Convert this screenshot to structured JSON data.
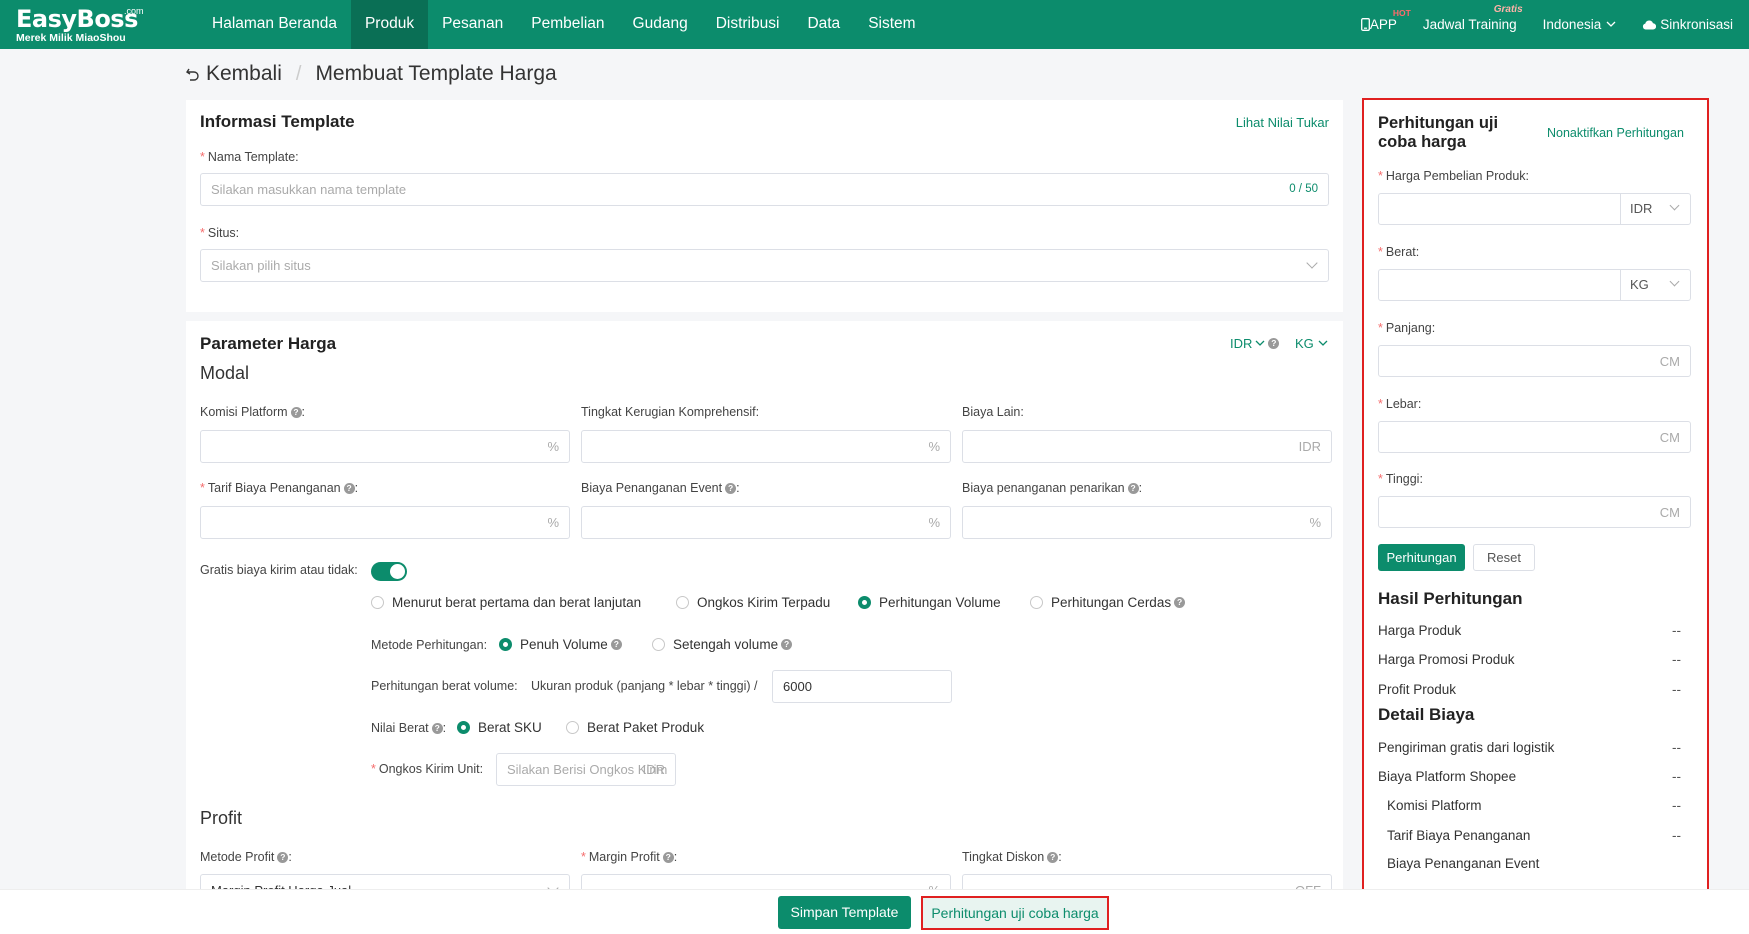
{
  "nav": {
    "logo": "EasyBoss",
    "logo_com": ".com",
    "logo_tag": "Merek Milik MiaoShou",
    "menu": [
      "Halaman Beranda",
      "Produk",
      "Pesanan",
      "Pembelian",
      "Gudang",
      "Distribusi",
      "Data",
      "Sistem"
    ],
    "active_index": 1,
    "app": "APP",
    "app_badge": "HOT",
    "training": "Jadwal Training",
    "training_badge": "Gratis",
    "language": "Indonesia",
    "sync": "Sinkronisasi"
  },
  "header": {
    "back": "Kembali",
    "separator": "/",
    "title": "Membuat Template Harga"
  },
  "template_info": {
    "title": "Informasi Template",
    "exchange_link": "Lihat Nilai Tukar",
    "name_label": "Nama Template:",
    "name_placeholder": "Silakan masukkan nama template",
    "name_count": "0 / 50",
    "site_label": "Situs:",
    "site_placeholder": "Silakan pilih situs"
  },
  "price_params": {
    "title": "Parameter Harga",
    "currency": "IDR",
    "weight_unit": "KG",
    "modal_title": "Modal",
    "commission_label": "Komisi Platform",
    "commission_suffix": "%",
    "loss_label": "Tingkat Kerugian Komprehensif:",
    "loss_suffix": "%",
    "other_label": "Biaya Lain:",
    "other_suffix": "IDR",
    "handling_label": "Tarif Biaya Penanganan",
    "handling_suffix": "%",
    "event_label": "Biaya Penanganan Event",
    "event_suffix": "%",
    "withdraw_label": "Biaya penanganan penarikan",
    "withdraw_suffix": "%",
    "free_ship_label": "Gratis biaya kirim atau tidak:",
    "free_ship_on": true,
    "ship_options": [
      "Menurut berat pertama dan berat lanjutan",
      "Ongkos Kirim Terpadu",
      "Perhitungan Volume",
      "Perhitungan Cerdas"
    ],
    "ship_selected": 2,
    "calc_method_label": "Metode Perhitungan:",
    "calc_options": [
      "Penuh Volume",
      "Setengah volume"
    ],
    "calc_selected": 0,
    "vol_label": "Perhitungan berat volume:",
    "vol_formula": "Ukuran produk (panjang * lebar * tinggi) /",
    "vol_value": "6000",
    "weight_value_label": "Nilai Berat",
    "weight_options": [
      "Berat SKU",
      "Berat Paket Produk"
    ],
    "weight_selected": 0,
    "unit_ship_label": "Ongkos Kirim Unit:",
    "unit_ship_placeholder": "Silakan Berisi Ongkos Kirim",
    "unit_ship_suffix": "IDR",
    "profit_title": "Profit",
    "profit_method_label": "Metode Profit",
    "profit_method_value": "Margin Profit Harga Jual",
    "profit_margin_label": "Margin Profit",
    "profit_margin_suffix": "%",
    "discount_label": "Tingkat Diskon",
    "discount_suffix": "OFF"
  },
  "trial": {
    "title": "Perhitungan uji coba harga",
    "disable_link": "Nonaktifkan Perhitungan",
    "purchase_label": "Harga Pembelian Produk:",
    "purchase_unit": "IDR",
    "weight_label": "Berat:",
    "weight_unit": "KG",
    "length_label": "Panjang:",
    "width_label": "Lebar:",
    "height_label": "Tinggi:",
    "dim_unit": "CM",
    "calc_button": "Perhitungan",
    "reset_button": "Reset",
    "result_title": "Hasil Perhitungan",
    "results": [
      {
        "label": "Harga Produk",
        "value": "--"
      },
      {
        "label": "Harga Promosi Produk",
        "value": "--"
      },
      {
        "label": "Profit Produk",
        "value": "--"
      }
    ],
    "detail_title": "Detail Biaya",
    "details": [
      {
        "label": "Pengiriman gratis dari logistik",
        "value": "--"
      },
      {
        "label": "Biaya Platform Shopee",
        "value": "--"
      },
      {
        "label": "Komisi Platform",
        "value": "--"
      },
      {
        "label": "Tarif Biaya Penanganan",
        "value": "--"
      },
      {
        "label": "Biaya Penanganan Event",
        "value": ""
      }
    ]
  },
  "footer": {
    "save": "Simpan Template",
    "trial": "Perhitungan uji coba harga"
  },
  "colors": {
    "brand": "#0c8c6c",
    "highlight": "#e02020"
  }
}
